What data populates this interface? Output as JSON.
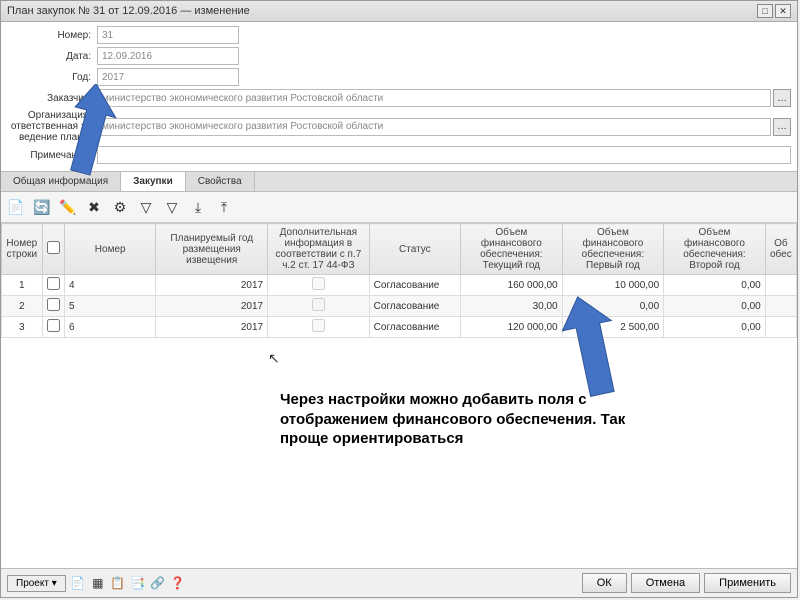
{
  "window": {
    "title": "План закупок № 31 от 12.09.2016 — изменение"
  },
  "form": {
    "number_label": "Номер:",
    "number_value": "31",
    "date_label": "Дата:",
    "date_value": "12.09.2016",
    "year_label": "Год:",
    "year_value": "2017",
    "customer_label": "Заказчик:",
    "customer_value": "министерство экономического развития Ростовской области",
    "org_label": "Организация, ответственная за ведение плана:",
    "org_value": "министерство экономического развития Ростовской области",
    "note_label": "Примечание:",
    "note_value": ""
  },
  "tabs": {
    "t1": "Общая информация",
    "t2": "Закупки",
    "t3": "Свойства"
  },
  "grid": {
    "headers": {
      "rownum": "Номер строки",
      "number": "Номер",
      "plan_year": "Планируемый год размещения извещения",
      "extra_info": "Дополнительная информация в соответствии с п.7 ч.2 ст. 17 44-ФЗ",
      "status": "Статус",
      "fin_current": "Объем финансового обеспечения: Текущий год",
      "fin_first": "Объем финансового обеспечения: Первый год",
      "fin_second": "Объем финансового обеспечения: Второй год",
      "fin_more": "Об обес"
    },
    "rows": [
      {
        "n": "1",
        "num": "4",
        "year": "2017",
        "status": "Согласование",
        "cur": "160 000,00",
        "first": "10 000,00",
        "second": "0,00"
      },
      {
        "n": "2",
        "num": "5",
        "year": "2017",
        "status": "Согласование",
        "cur": "30,00",
        "first": "0,00",
        "second": "0,00"
      },
      {
        "n": "3",
        "num": "6",
        "year": "2017",
        "status": "Согласование",
        "cur": "120 000,00",
        "first": "2 500,00",
        "second": "0,00"
      }
    ]
  },
  "annotation": "Через настройки можно добавить поля с отображением финансового обеспечения. Так проще ориентироваться",
  "footer": {
    "project": "Проект ▾",
    "ok": "ОК",
    "cancel": "Отмена",
    "apply": "Применить"
  }
}
